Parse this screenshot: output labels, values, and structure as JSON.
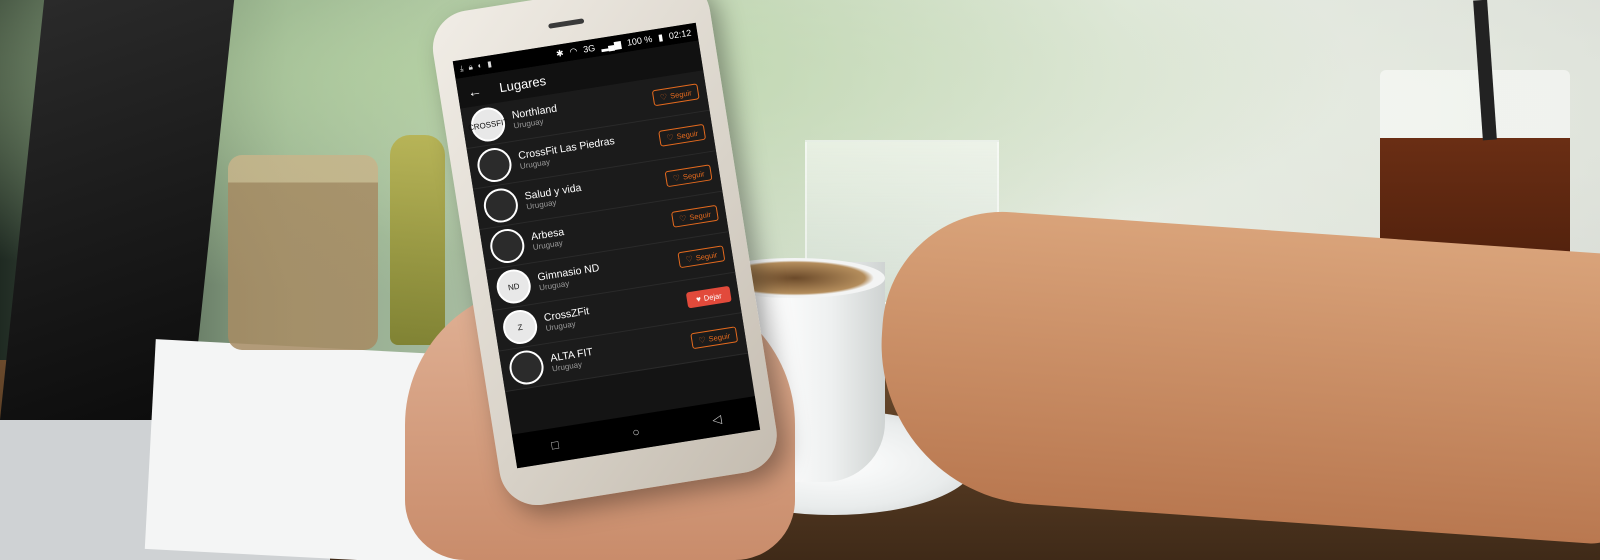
{
  "status_bar": {
    "network": "3G",
    "battery": "100 %",
    "time": "02:12"
  },
  "app_bar": {
    "back_icon": "arrow-left-icon",
    "title": "Lugares"
  },
  "places": [
    {
      "name": "Northland",
      "country": "Uruguay",
      "avatar_label": "CROSSFIT",
      "button": "Seguir",
      "following": false
    },
    {
      "name": "CrossFit Las Piedras",
      "country": "Uruguay",
      "avatar_label": "",
      "button": "Seguir",
      "following": false
    },
    {
      "name": "Salud y vida",
      "country": "Uruguay",
      "avatar_label": "",
      "button": "Seguir",
      "following": false
    },
    {
      "name": "Arbesa",
      "country": "Uruguay",
      "avatar_label": "",
      "button": "Seguir",
      "following": false
    },
    {
      "name": "Gimnasio ND",
      "country": "Uruguay",
      "avatar_label": "ND",
      "button": "Seguir",
      "following": false
    },
    {
      "name": "CrossZFit",
      "country": "Uruguay",
      "avatar_label": "Z",
      "button": "Dejar",
      "following": true
    },
    {
      "name": "ALTA FIT",
      "country": "Uruguay",
      "avatar_label": "",
      "button": "Seguir",
      "following": false
    }
  ],
  "nav_bar": {
    "recent_icon": "square-icon",
    "home_icon": "circle-icon",
    "back_icon": "triangle-left-icon"
  },
  "colors": {
    "accent": "#e46a1e",
    "following": "#e24a3b",
    "screen_bg": "#141414"
  }
}
